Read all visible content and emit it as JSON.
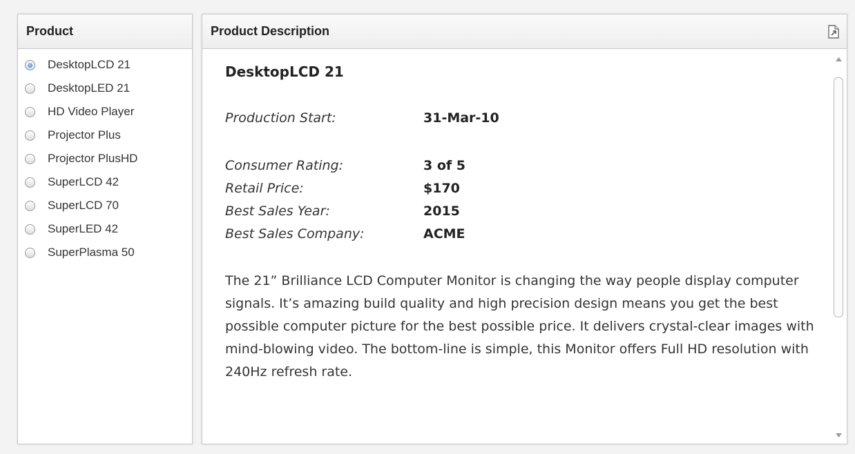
{
  "product_panel": {
    "header": "Product",
    "items": [
      {
        "label": "DesktopLCD 21",
        "selected": true
      },
      {
        "label": "DesktopLED 21",
        "selected": false
      },
      {
        "label": "HD Video Player",
        "selected": false
      },
      {
        "label": "Projector Plus",
        "selected": false
      },
      {
        "label": "Projector PlusHD",
        "selected": false
      },
      {
        "label": "SuperLCD 42",
        "selected": false
      },
      {
        "label": "SuperLCD 70",
        "selected": false
      },
      {
        "label": "SuperLED 42",
        "selected": false
      },
      {
        "label": "SuperPlasma 50",
        "selected": false
      }
    ]
  },
  "description_panel": {
    "header": "Product Description",
    "export_icon": "export-document-icon",
    "product_name": "DesktopLCD 21",
    "production_start": {
      "label": "Production Start:",
      "value": "31-Mar-10"
    },
    "specs": [
      {
        "label": "Consumer Rating:",
        "value": "3 of 5"
      },
      {
        "label": "Retail Price:",
        "value": "$170"
      },
      {
        "label": "Best Sales Year:",
        "value": "2015"
      },
      {
        "label": "Best Sales Company:",
        "value": "ACME"
      }
    ],
    "description": "The 21” Brilliance LCD Computer Monitor is changing the way people display computer signals. It’s amazing build quality and high precision design means you get the best possible computer picture for the best possible price. It delivers crystal-clear images with mind-blowing video. The bottom-line is simple, this Monitor offers Full HD resolution with 240Hz refresh rate."
  },
  "colors": {
    "radio_selected": "#3f73b8",
    "border": "#c9c9c9"
  }
}
